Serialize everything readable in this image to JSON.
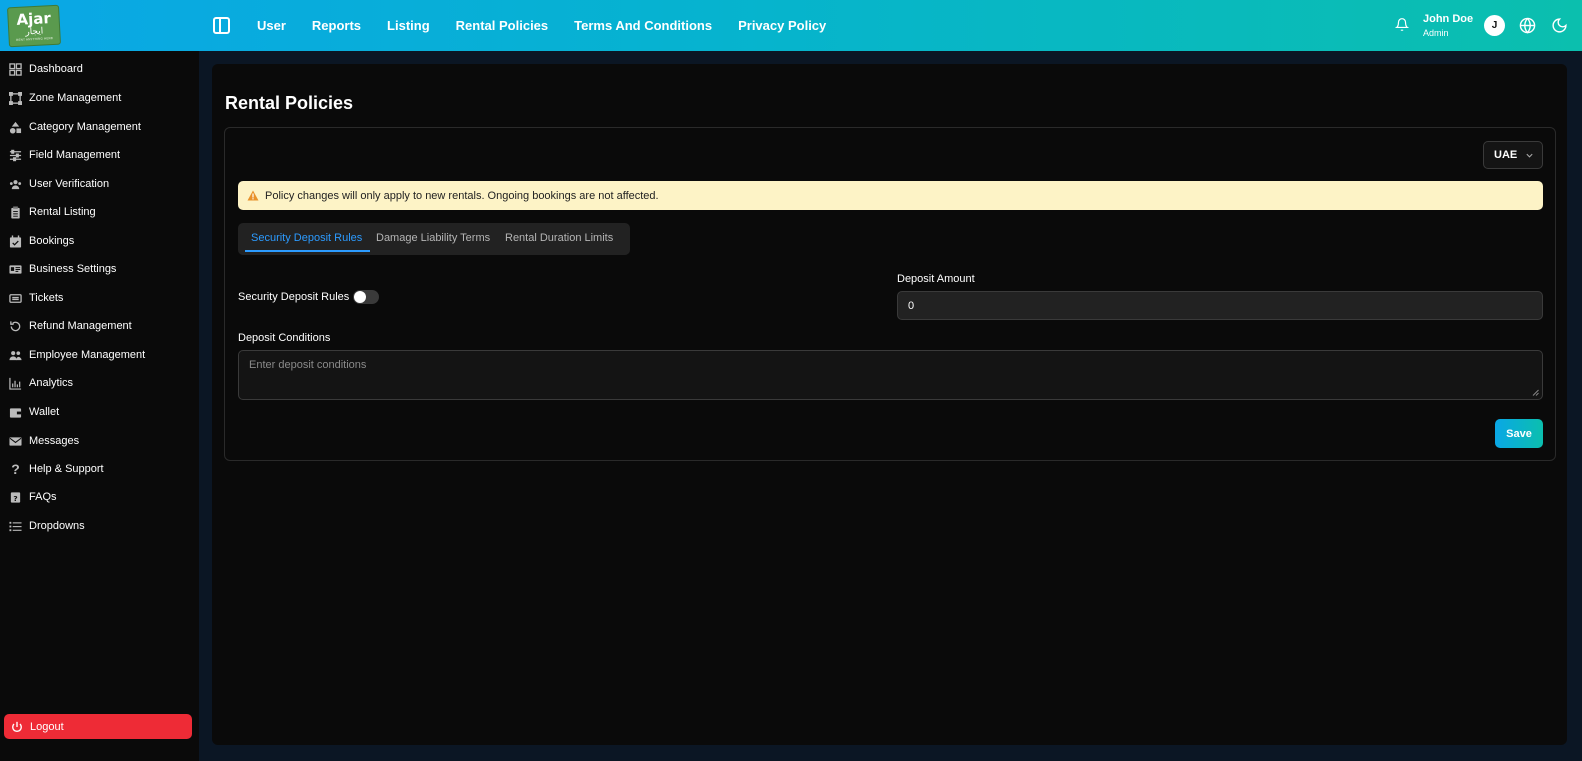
{
  "logo": {
    "line1": "Ajar",
    "line2": "ايجار",
    "line3": "RENT ANYTHING HERE"
  },
  "header": {
    "nav": [
      "User",
      "Reports",
      "Listing",
      "Rental Policies",
      "Terms And Conditions",
      "Privacy Policy"
    ],
    "user_name": "John Doe",
    "user_role": "Admin",
    "avatar_initial": "J"
  },
  "sidebar": {
    "items": [
      {
        "label": "Dashboard",
        "icon": "dashboard-icon"
      },
      {
        "label": "Zone Management",
        "icon": "zone-icon"
      },
      {
        "label": "Category Management",
        "icon": "category-icon"
      },
      {
        "label": "Field Management",
        "icon": "sliders-icon"
      },
      {
        "label": "User Verification",
        "icon": "users-icon"
      },
      {
        "label": "Rental Listing",
        "icon": "clipboard-icon"
      },
      {
        "label": "Bookings",
        "icon": "calendar-icon"
      },
      {
        "label": "Business Settings",
        "icon": "id-card-icon"
      },
      {
        "label": "Tickets",
        "icon": "ticket-icon"
      },
      {
        "label": "Refund Management",
        "icon": "refund-icon"
      },
      {
        "label": "Employee Management",
        "icon": "employees-icon"
      },
      {
        "label": "Analytics",
        "icon": "analytics-icon"
      },
      {
        "label": "Wallet",
        "icon": "wallet-icon"
      },
      {
        "label": "Messages",
        "icon": "mail-icon"
      },
      {
        "label": "Help & Support",
        "icon": "question-icon"
      },
      {
        "label": "FAQs",
        "icon": "faq-icon"
      },
      {
        "label": "Dropdowns",
        "icon": "list-icon"
      }
    ],
    "logout_label": "Logout"
  },
  "page": {
    "title": "Rental Policies",
    "country": "UAE",
    "alert": "Policy changes will only apply to new rentals. Ongoing bookings are not affected.",
    "tabs": [
      "Security Deposit Rules",
      "Damage Liability Terms",
      "Rental Duration Limits"
    ],
    "active_tab": 0,
    "security_deposit_label": "Security Deposit Rules",
    "security_deposit_enabled": false,
    "deposit_amount_label": "Deposit Amount",
    "deposit_amount_value": "0",
    "deposit_conditions_label": "Deposit Conditions",
    "deposit_conditions_placeholder": "Enter deposit conditions",
    "save_label": "Save"
  },
  "colors": {
    "header_gradient_start": "#0aa7e6",
    "header_gradient_end": "#0bbfae",
    "logout": "#ee2b36",
    "active_tab": "#2c9bff",
    "alert_bg": "#fdf3c6"
  }
}
